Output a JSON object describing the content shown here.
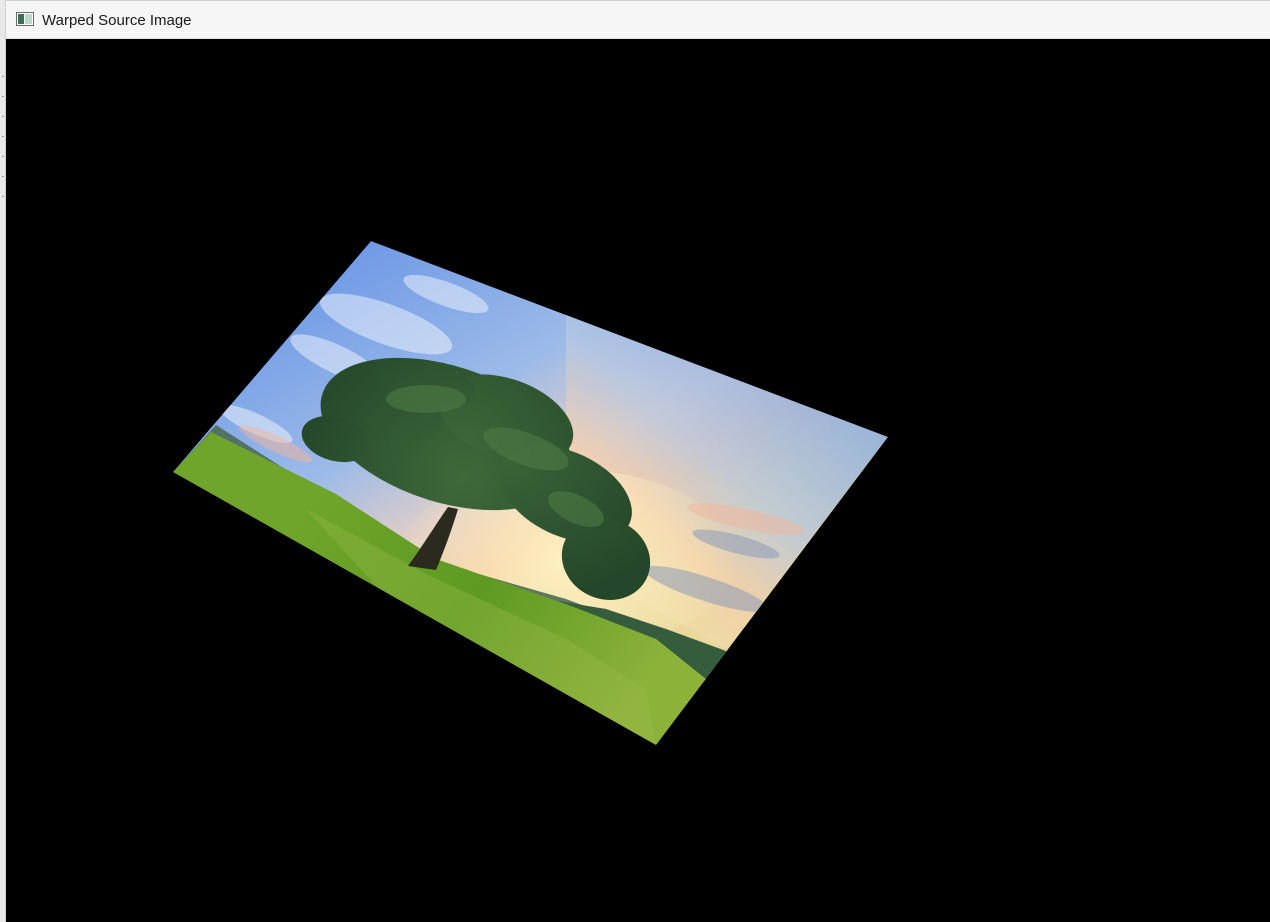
{
  "window": {
    "title": "Warped Source Image",
    "icon": "image-window-icon"
  },
  "canvas": {
    "background": "#000000",
    "content": "warped-photo"
  },
  "colors": {
    "titlebar_bg": "#f6f6f6",
    "title_text": "#1a1a1a",
    "canvas_bg": "#000000",
    "sky_top": "#6f9fe8",
    "grass": "#6fa12a"
  }
}
